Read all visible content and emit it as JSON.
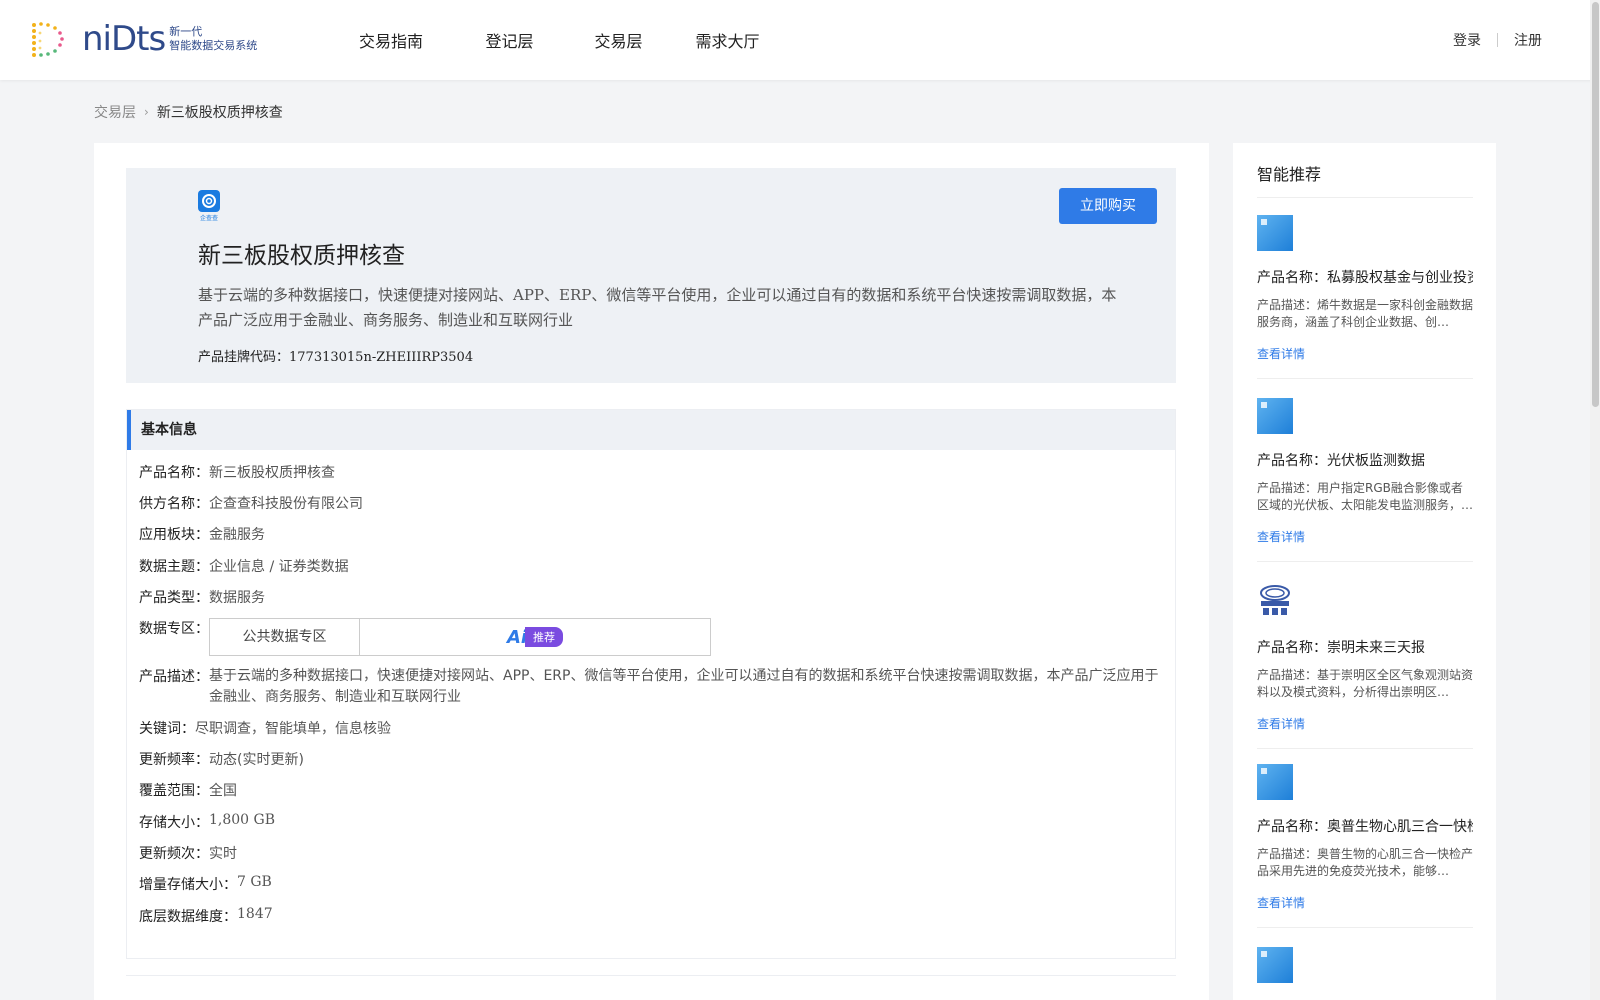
{
  "header": {
    "logo_word": "niDts",
    "logo_sub1": "新一代",
    "logo_sub2": "智能数据交易系统",
    "nav": [
      "交易指南",
      "登记层",
      "交易层",
      "需求大厅"
    ],
    "login": "登录",
    "register": "注册"
  },
  "breadcrumb": {
    "parent": "交易层",
    "current": "新三板股权质押核查"
  },
  "hero": {
    "provider_logo_text": "企查查",
    "title": "新三板股权质押核查",
    "desc": "基于云端的多种数据接口，快速便捷对接网站、APP、ERP、微信等平台使用，企业可以通过自有的数据和系统平台快速按需调取数据，本产品广泛应用于金融业、商务服务、制造业和互联网行业",
    "code_label": "产品挂牌代码：",
    "code_value": "177313015n-ZHEIIIRP3504",
    "buy_label": "立即购买"
  },
  "info": {
    "heading": "基本信息",
    "rows": [
      {
        "k": "产品名称：",
        "v": "新三板股权质押核查"
      },
      {
        "k": "供方名称：",
        "v": "企查查科技股份有限公司"
      },
      {
        "k": "应用板块：",
        "v": "金融服务"
      },
      {
        "k": "数据主题：",
        "v": "企业信息 / 证券类数据"
      },
      {
        "k": "产品类型：",
        "v": "数据服务"
      },
      {
        "k": "数据专区：",
        "v": ""
      },
      {
        "k": "产品描述：",
        "v": "基于云端的多种数据接口，快速便捷对接网站、APP、ERP、微信等平台使用，企业可以通过自有的数据和系统平台快速按需调取数据，本产品广泛应用于金融业、商务服务、制造业和互联网行业"
      },
      {
        "k": "关键词：",
        "v": "尽职调查，智能填单，信息核验"
      },
      {
        "k": "更新频率：",
        "v": "动态(实时更新)"
      },
      {
        "k": "覆盖范围：",
        "v": "全国"
      },
      {
        "k": "存储大小：",
        "v": "1,800 GB"
      },
      {
        "k": "更新频次：",
        "v": "实时"
      },
      {
        "k": "增量存储大小：",
        "v": "7 GB"
      },
      {
        "k": "底层数据维度：",
        "v": "1847"
      }
    ],
    "zone_name": "公共数据专区",
    "ai_mark": "Ai",
    "ai_tag": "推荐"
  },
  "sidebar": {
    "title": "智能推荐",
    "items": [
      {
        "name": "产品名称：私募股权基金与创业投资",
        "desc": "产品描述：烯牛数据是一家科创金融数据服务商，涵盖了科创企业数据、创…",
        "link": "查看详情",
        "thumb": "blue"
      },
      {
        "name": "产品名称：光伏板监测数据",
        "desc": "产品描述：用户指定RGB融合影像或者区域的光伏板、太阳能发电监测服务，…",
        "link": "查看详情",
        "thumb": "blue"
      },
      {
        "name": "产品名称：崇明未来三天报",
        "desc": "产品描述：基于崇明区全区气象观测站资料以及模式资料，分析得出崇明区…",
        "link": "查看详情",
        "thumb": "weather"
      },
      {
        "name": "产品名称：奥普生物心肌三合一快检",
        "desc": "产品描述：奥普生物的心肌三合一快检产品采用先进的免疫荧光技术，能够…",
        "link": "查看详情",
        "thumb": "blue"
      }
    ]
  }
}
